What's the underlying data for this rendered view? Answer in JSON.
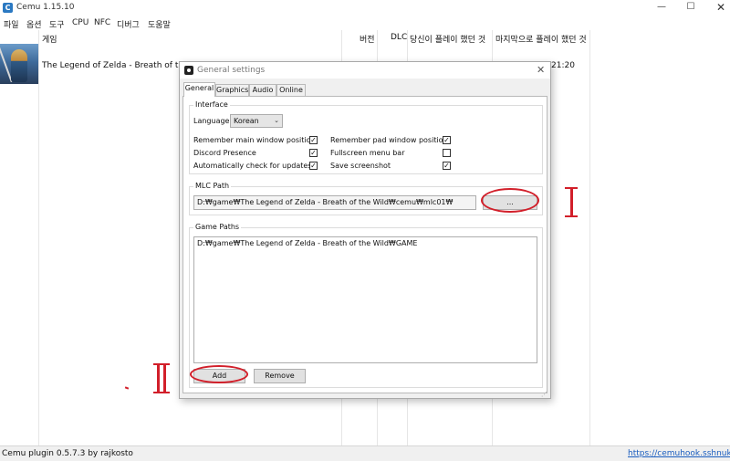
{
  "app": {
    "title": "Cemu 1.15.10",
    "icon_letter": "C"
  },
  "window_controls": {
    "minimize": "—",
    "maximize": "☐",
    "close": "✕"
  },
  "menu": [
    "파일",
    "옵션",
    "도구",
    "CPU",
    "NFC",
    "디버그",
    "도움말"
  ],
  "list": {
    "columns": [
      "게임",
      "버전",
      "DLC",
      "당신이 플레이 했던 것",
      "마지막으로 플레이 했던 것"
    ],
    "rows": [
      {
        "name": "The Legend of Zelda - Breath of the Wild",
        "last_played": "21:20"
      }
    ]
  },
  "dialog": {
    "title": "General settings",
    "close_glyph": "✕",
    "tabs": [
      "General",
      "Graphics",
      "Audio",
      "Online"
    ],
    "active_tab": "General",
    "interface": {
      "title": "Interface",
      "language_label": "Language",
      "language_value": "Korean",
      "options_left": [
        {
          "label": "Remember main window position",
          "checked": true
        },
        {
          "label": "Discord Presence",
          "checked": true
        },
        {
          "label": "Automatically check for updates",
          "checked": true
        }
      ],
      "options_right": [
        {
          "label": "Remember pad window position",
          "checked": true
        },
        {
          "label": "Fullscreen menu bar",
          "checked": false
        },
        {
          "label": "Save screenshot",
          "checked": true
        }
      ]
    },
    "mlc": {
      "title": "MLC Path",
      "path": "D:₩game₩The Legend of Zelda - Breath of the Wild₩cemu₩mlc01₩",
      "browse_label": "..."
    },
    "game_paths": {
      "title": "Game Paths",
      "items": [
        "D:₩game₩The Legend of Zelda - Breath of the Wild₩GAME"
      ],
      "add_label": "Add",
      "remove_label": "Remove"
    }
  },
  "status": {
    "left": "Cemu plugin 0.5.7.3 by rajkosto",
    "link": "https://cemuhook.sshnuke.net"
  },
  "annotation_color": "#d21f2a"
}
